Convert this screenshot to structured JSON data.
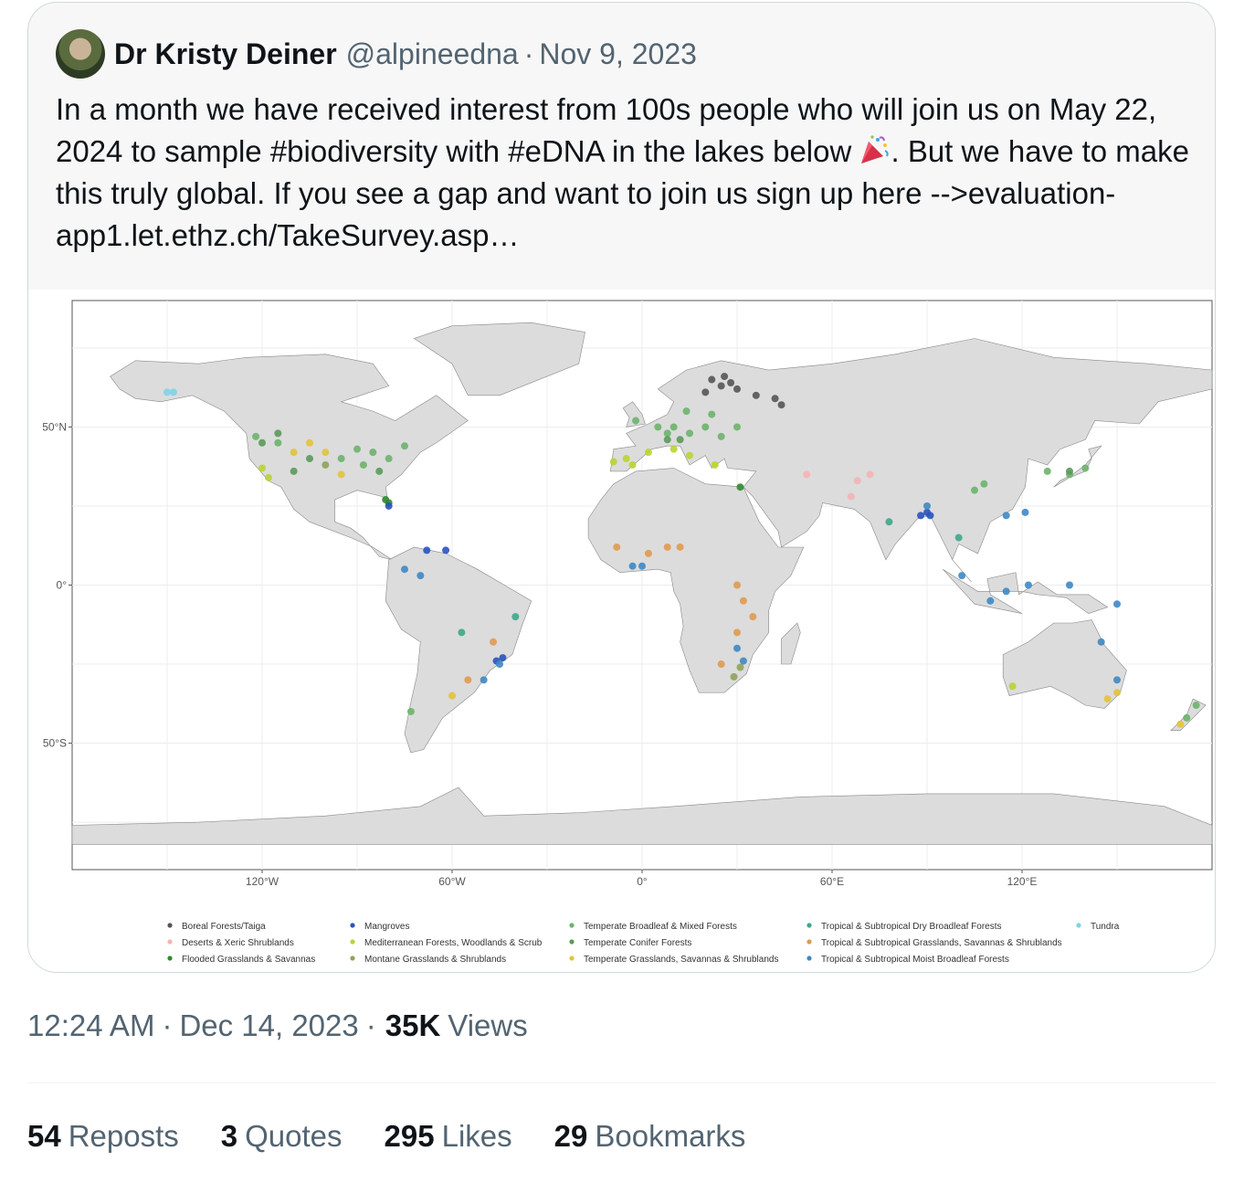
{
  "quoted_tweet": {
    "author_name": "Dr Kristy Deiner",
    "handle": "@alpineedna",
    "separator": "·",
    "date": "Nov 9, 2023",
    "text": "In a month we have received interest from 100s people who will join us on May 22, 2024 to sample #biodiversity with #eDNA in the lakes below",
    "text_after_emoji": ". But we have to make this truly global. If you see a gap and want to join us sign up here -->evaluation-app1.let.ethz.ch/TakeSurvey.asp…",
    "emoji": "party-popper-icon"
  },
  "chart_data": {
    "type": "scatter",
    "title": "",
    "xlabel": "",
    "ylabel": "",
    "x_ticks": [
      "120°W",
      "60°W",
      "0°",
      "60°E",
      "120°E"
    ],
    "x_tick_values": [
      -120,
      -60,
      0,
      60,
      120
    ],
    "y_ticks": [
      "50°N",
      "0°",
      "50°S"
    ],
    "y_tick_values": [
      50,
      0,
      -50
    ],
    "xlim": [
      -180,
      180
    ],
    "ylim": [
      -90,
      90
    ],
    "grid": true,
    "legend_position": "bottom",
    "series": [
      {
        "name": "Boreal Forests/Taiga",
        "color": "#555555",
        "points": [
          [
            25,
            63
          ],
          [
            28,
            64
          ],
          [
            22,
            65
          ],
          [
            30,
            62
          ],
          [
            26,
            66
          ],
          [
            36,
            60
          ],
          [
            42,
            59
          ],
          [
            44,
            57
          ],
          [
            20,
            61
          ]
        ]
      },
      {
        "name": "Deserts & Xeric Shrublands",
        "color": "#f4b4b4",
        "points": [
          [
            52,
            35
          ],
          [
            68,
            33
          ],
          [
            66,
            28
          ],
          [
            72,
            35
          ]
        ]
      },
      {
        "name": "Flooded Grasslands & Savannas",
        "color": "#2e8b2e",
        "points": [
          [
            -81,
            27
          ],
          [
            31,
            31
          ],
          [
            -80,
            26
          ]
        ]
      },
      {
        "name": "Mangroves",
        "color": "#2a52be",
        "points": [
          [
            -80,
            25
          ],
          [
            -68,
            11
          ],
          [
            -62,
            11
          ],
          [
            90,
            23
          ],
          [
            91,
            22
          ],
          [
            -46,
            -24
          ],
          [
            -44,
            -23
          ],
          [
            88,
            22
          ]
        ]
      },
      {
        "name": "Mediterranean Forests, Woodlands & Scrub",
        "color": "#b8d432",
        "points": [
          [
            -120,
            37
          ],
          [
            -118,
            34
          ],
          [
            -5,
            40
          ],
          [
            -3,
            38
          ],
          [
            2,
            42
          ],
          [
            10,
            43
          ],
          [
            15,
            41
          ],
          [
            23,
            38
          ],
          [
            -9,
            39
          ],
          [
            117,
            -32
          ]
        ]
      },
      {
        "name": "Montane Grasslands & Shrublands",
        "color": "#8fa35a",
        "points": [
          [
            29,
            -29
          ],
          [
            31,
            -26
          ],
          [
            -100,
            38
          ]
        ]
      },
      {
        "name": "Temperate Broadleaf & Mixed Forests",
        "color": "#6cb26c",
        "points": [
          [
            -90,
            43
          ],
          [
            -85,
            42
          ],
          [
            -80,
            40
          ],
          [
            -75,
            44
          ],
          [
            -95,
            40
          ],
          [
            -88,
            38
          ],
          [
            5,
            50
          ],
          [
            10,
            50
          ],
          [
            15,
            48
          ],
          [
            20,
            50
          ],
          [
            25,
            47
          ],
          [
            30,
            50
          ],
          [
            14,
            55
          ],
          [
            8,
            48
          ],
          [
            -2,
            52
          ],
          [
            22,
            54
          ],
          [
            105,
            30
          ],
          [
            108,
            32
          ],
          [
            128,
            36
          ],
          [
            135,
            35
          ],
          [
            140,
            37
          ],
          [
            -73,
            -40
          ],
          [
            172,
            -42
          ],
          [
            175,
            -38
          ],
          [
            -122,
            47
          ],
          [
            -115,
            45
          ]
        ]
      },
      {
        "name": "Temperate Conifer Forests",
        "color": "#5a9a5a",
        "points": [
          [
            -120,
            45
          ],
          [
            -115,
            48
          ],
          [
            -105,
            40
          ],
          [
            -110,
            36
          ],
          [
            12,
            46
          ],
          [
            8,
            46
          ],
          [
            135,
            36
          ],
          [
            -83,
            36
          ]
        ]
      },
      {
        "name": "Temperate Grasslands, Savannas & Shrublands",
        "color": "#e3c23a",
        "points": [
          [
            -100,
            42
          ],
          [
            -105,
            45
          ],
          [
            -95,
            35
          ],
          [
            -110,
            42
          ],
          [
            -60,
            -35
          ],
          [
            147,
            -36
          ],
          [
            150,
            -34
          ],
          [
            170,
            -44
          ]
        ]
      },
      {
        "name": "Tropical & Subtropical Dry Broadleaf Forests",
        "color": "#3fa68b",
        "points": [
          [
            78,
            20
          ],
          [
            100,
            15
          ],
          [
            -40,
            -10
          ],
          [
            -57,
            -15
          ]
        ]
      },
      {
        "name": "Tropical & Subtropical Grasslands, Savannas & Shrublands",
        "color": "#e09a50",
        "points": [
          [
            -8,
            12
          ],
          [
            2,
            10
          ],
          [
            8,
            12
          ],
          [
            30,
            0
          ],
          [
            32,
            -5
          ],
          [
            35,
            -10
          ],
          [
            30,
            -15
          ],
          [
            -47,
            -18
          ],
          [
            -55,
            -30
          ],
          [
            25,
            -25
          ],
          [
            12,
            12
          ]
        ]
      },
      {
        "name": "Tropical & Subtropical Moist Broadleaf Forests",
        "color": "#3d88c5",
        "points": [
          [
            -70,
            3
          ],
          [
            -75,
            5
          ],
          [
            -45,
            -25
          ],
          [
            101,
            3
          ],
          [
            110,
            -5
          ],
          [
            115,
            -2
          ],
          [
            122,
            0
          ],
          [
            135,
            0
          ],
          [
            150,
            -6
          ],
          [
            145,
            -18
          ],
          [
            150,
            -30
          ],
          [
            -50,
            -30
          ],
          [
            90,
            25
          ],
          [
            121,
            23
          ],
          [
            115,
            22
          ],
          [
            0,
            6
          ],
          [
            -3,
            6
          ],
          [
            30,
            -20
          ],
          [
            32,
            -24
          ]
        ]
      },
      {
        "name": "Tundra",
        "color": "#7fd3e6",
        "points": [
          [
            -150,
            61
          ],
          [
            -148,
            61
          ]
        ]
      }
    ]
  },
  "footer": {
    "time": "12:24 AM",
    "separator": "·",
    "date": "Dec 14, 2023",
    "views_count": "35K",
    "views_label": "Views"
  },
  "stats": [
    {
      "count": "54",
      "label": "Reposts"
    },
    {
      "count": "3",
      "label": "Quotes"
    },
    {
      "count": "295",
      "label": "Likes"
    },
    {
      "count": "29",
      "label": "Bookmarks"
    }
  ],
  "colors": {
    "text_primary": "#0f1419",
    "text_secondary": "#536471",
    "land": "#dcdcdc",
    "border": "#cfd9de"
  }
}
